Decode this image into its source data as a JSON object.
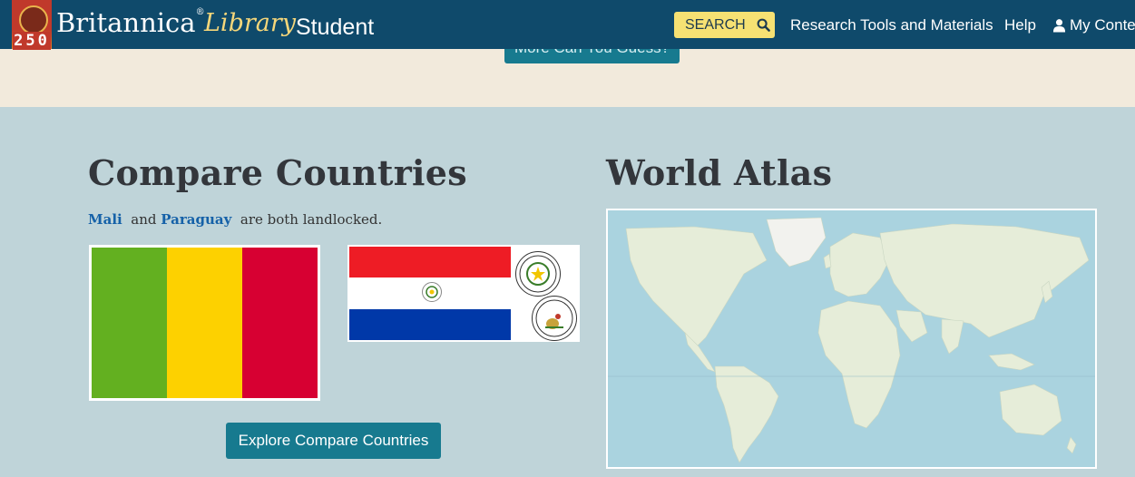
{
  "header": {
    "badge_number": "250",
    "brand": "Britannica",
    "brand_mark": "®",
    "library": "Library",
    "product": "Student",
    "search_label": "SEARCH",
    "nav": {
      "research": "Research Tools and Materials",
      "help": "Help",
      "my_content": "My Conten"
    }
  },
  "promo": {
    "button_label": "More Can You Guess?"
  },
  "compare": {
    "title": "Compare Countries",
    "country1": "Mali",
    "connector": "and",
    "country2": "Paraguay",
    "suffix": "are both landlocked.",
    "button_label": "Explore Compare Countries",
    "mali_colors": [
      "#63b020",
      "#fdd100",
      "#d70032"
    ],
    "paraguay_colors": [
      "#ee1c25",
      "#ffffff",
      "#0038a8"
    ]
  },
  "atlas": {
    "title": "World Atlas",
    "ocean_color": "#aad3df",
    "land_color": "#e6edd9"
  },
  "colors": {
    "header_bg": "#0f4a6b",
    "accent": "#177a8f",
    "search_bg": "#f6e173",
    "body_bg": "#bfd4d9",
    "cream": "#f2eadc"
  }
}
